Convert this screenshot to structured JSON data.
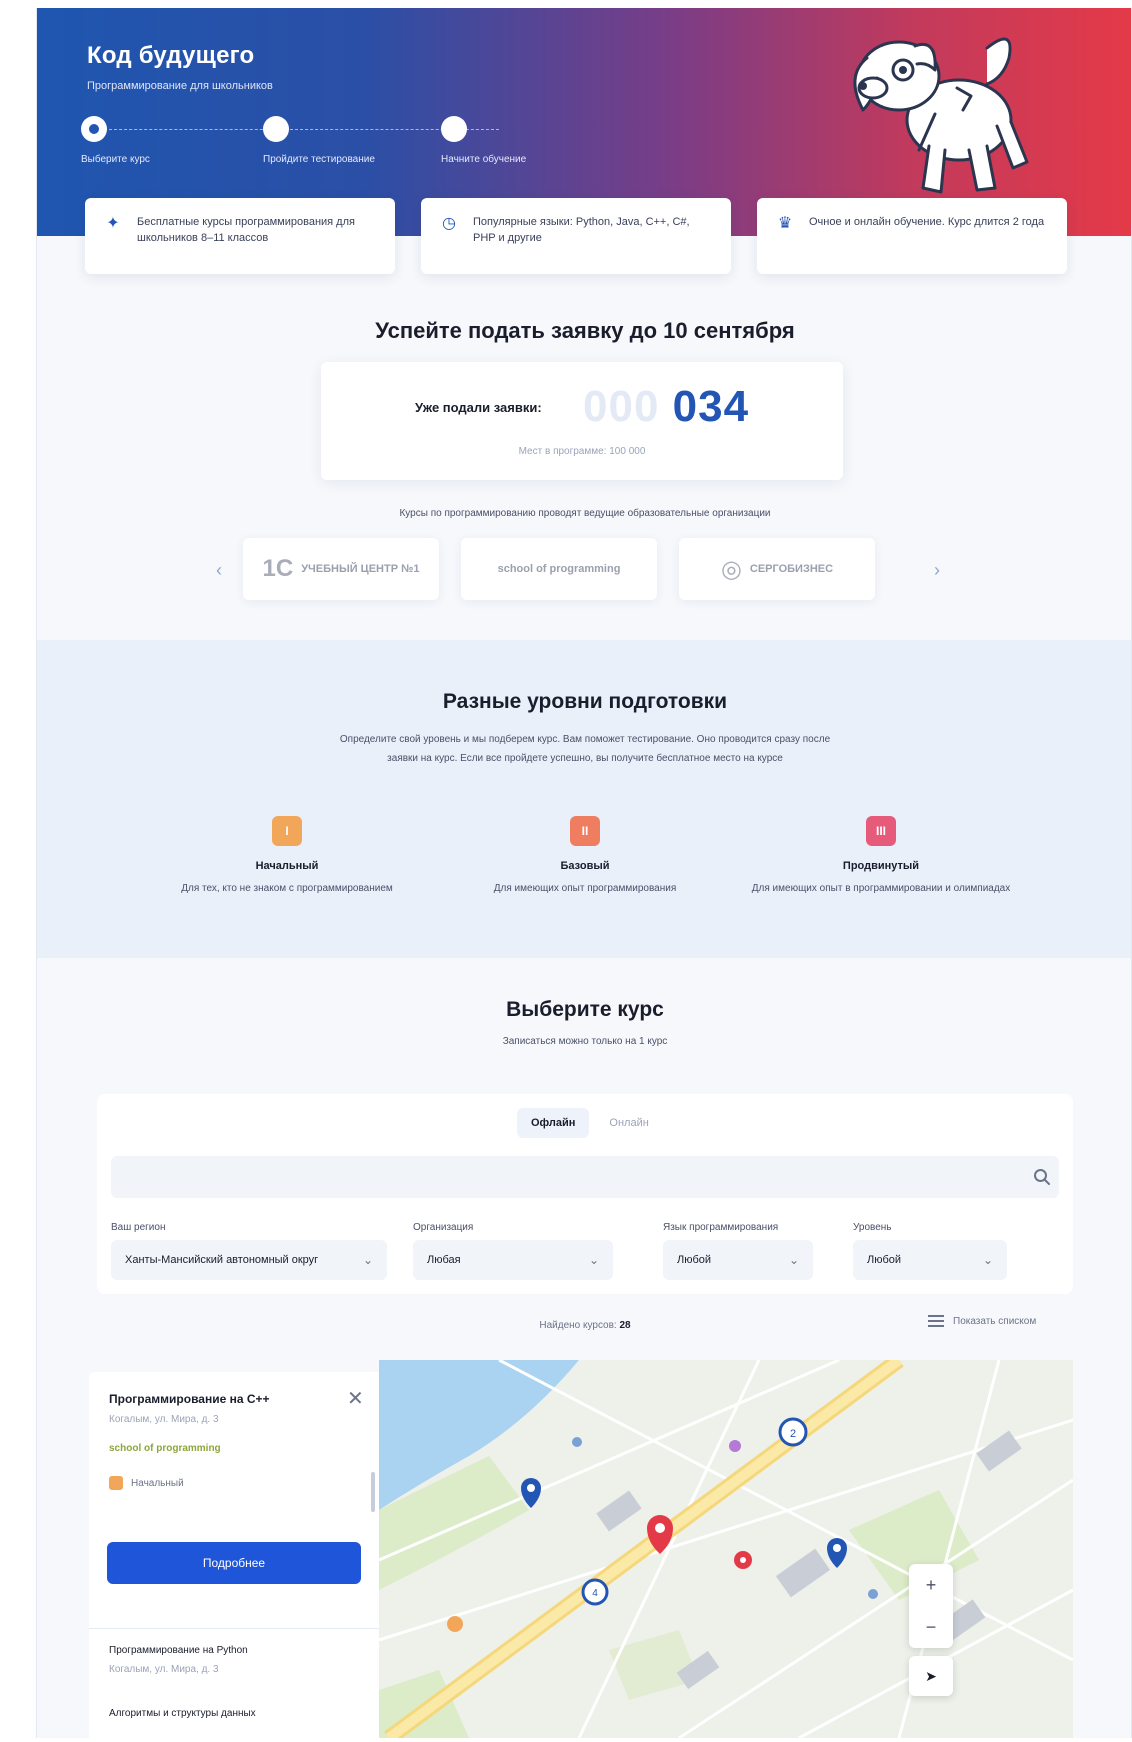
{
  "hero": {
    "title": "Код будущего",
    "subtitle": "Программирование для школьников",
    "steps": [
      "Выберите курс",
      "Пройдите тестирование",
      "Начните обучение"
    ],
    "features": [
      {
        "icon": "sparkle-icon",
        "text": "Бесплатные курсы программирования для школьников 8–11 классов"
      },
      {
        "icon": "clock-icon",
        "text": "Популярные языки: Python, Java, C++, C#, PHP и другие"
      },
      {
        "icon": "crown-icon",
        "text": "Очное и онлайн обучение. Курс длится 2 года"
      }
    ]
  },
  "deadline": {
    "title": "Успейте подать заявку до 10 сентября",
    "counter_label": "Уже подали заявки:",
    "counter_dim": "000",
    "counter_value": "034",
    "counter_sub": "Мест в программе: 100 000"
  },
  "partners": {
    "caption": "Курсы по программированию проводят ведущие образовательные организации",
    "items": [
      {
        "mark": "1С",
        "name": "УЧЕБНЫЙ ЦЕНТР №1"
      },
      {
        "mark": "",
        "name": "school of programming"
      },
      {
        "mark": "◎",
        "name": "СЕРГОБИЗНЕС"
      }
    ],
    "prev_arrow": "‹",
    "next_arrow": "›"
  },
  "levels": {
    "title": "Разные уровни подготовки",
    "description": "Определите свой уровень и мы подберем курс. Вам поможет тестирование. Оно проводится сразу после заявки на курс. Если все пройдете успешно, вы получите бесплатное место на курсе",
    "items": [
      {
        "icon": "I",
        "color": "#f2a65a",
        "name": "Начальный",
        "desc": "Для тех, кто не знаком с программированием"
      },
      {
        "icon": "II",
        "color": "#ef7d5f",
        "name": "Базовый",
        "desc": "Для имеющих опыт программирования"
      },
      {
        "icon": "III",
        "color": "#e65a7a",
        "name": "Продвинутый",
        "desc": "Для имеющих опыт в программировании и олимпиадах"
      }
    ]
  },
  "course": {
    "title": "Выберите курс",
    "subtitle": "Записаться можно только на 1 курс",
    "tabs": [
      "Офлайн",
      "Онлайн"
    ],
    "search_placeholder": "",
    "filters": [
      {
        "label": "Ваш регион",
        "value": "Ханты-Мансийский автономный округ"
      },
      {
        "label": "Организация",
        "value": "Любая"
      },
      {
        "label": "Язык программирования",
        "value": "Любой"
      },
      {
        "label": "Уровень",
        "value": "Любой"
      }
    ],
    "found_label": "Найдено курсов:",
    "found_count": "28",
    "list_toggle": "Показать списком"
  },
  "map_panel": {
    "card": {
      "title": "Программирование на C++",
      "address": "Когалым, ул. Мира, д. 3",
      "organization": "school of programming",
      "level": "Начальный",
      "button": "Подробнее",
      "close": "✕"
    },
    "items": [
      {
        "title": "Программирование на Python",
        "address": "Когалым, ул. Мира, д. 3"
      },
      {
        "title": "Алгоритмы и структуры данных",
        "address": ""
      }
    ],
    "zoom_in": "+",
    "zoom_out": "−",
    "locate": "➤"
  },
  "colors": {
    "brand_blue": "#1f55d8",
    "accent_blue": "#2356b4",
    "hero_left": "#1f56b0",
    "hero_right": "#e43a48"
  }
}
